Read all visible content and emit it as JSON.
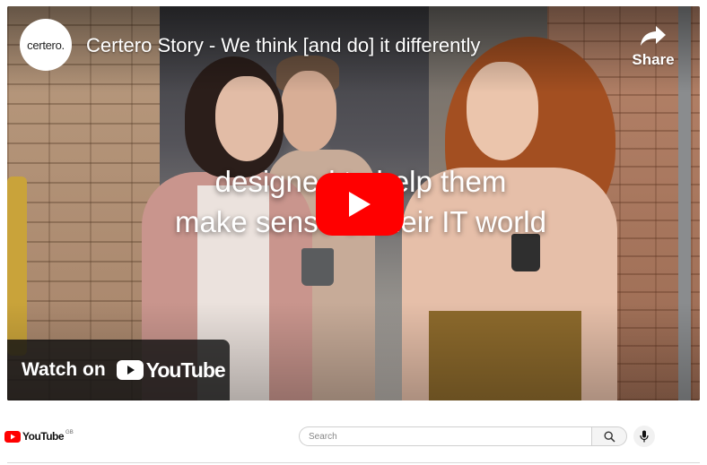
{
  "video": {
    "channel_logo_text": "certero.",
    "title": "Certero Story - We think [and do] it differently",
    "share_label": "Share",
    "caption_line1": "designed to help them",
    "caption_line2": "make sense of their IT world",
    "watch_on_label": "Watch on",
    "youtube_wordmark": "YouTube",
    "play_icon": "play-icon",
    "share_icon": "share-arrow-icon"
  },
  "masthead": {
    "logo_word": "YouTube",
    "country_code": "GB",
    "search_placeholder": "Search",
    "search_icon": "search-icon",
    "mic_icon": "microphone-icon"
  },
  "colors": {
    "youtube_red": "#ff0000",
    "watch_bar": "#141414"
  }
}
